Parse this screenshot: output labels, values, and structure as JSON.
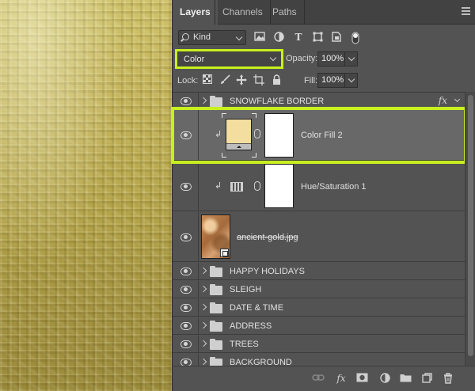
{
  "tabs": [
    {
      "label": "Layers",
      "active": true
    },
    {
      "label": "Channels",
      "active": false
    },
    {
      "label": "Paths",
      "active": false
    }
  ],
  "filter": {
    "kind_label": "Kind",
    "icons": [
      "image-filter-icon",
      "adjustment-filter-icon",
      "type-filter-icon",
      "shape-filter-icon",
      "smart-object-filter-icon",
      "filter-toggle-icon"
    ]
  },
  "blend": {
    "mode": "Color",
    "opacity_label": "Opacity:",
    "opacity_value": "100%"
  },
  "lock": {
    "label": "Lock:",
    "fill_label": "Fill:",
    "fill_value": "100%"
  },
  "layers": [
    {
      "name": "SNOWFLAKE BORDER",
      "type": "group",
      "fx": "fx"
    },
    {
      "name": "Color Fill 2",
      "type": "color-fill",
      "selected": true,
      "fill_color": "#f3dea0"
    },
    {
      "name": "Hue/Saturation 1",
      "type": "adjustment"
    },
    {
      "name": "ancient-gold.jpg",
      "type": "smart-object"
    },
    {
      "name": "HAPPY HOLIDAYS",
      "type": "group"
    },
    {
      "name": "SLEIGH",
      "type": "group"
    },
    {
      "name": "DATE & TIME",
      "type": "group"
    },
    {
      "name": "ADDRESS",
      "type": "group"
    },
    {
      "name": "TREES",
      "type": "group"
    },
    {
      "name": "BACKGROUND",
      "type": "group"
    }
  ],
  "colors": {
    "highlight": "#c8f01e",
    "panel_bg": "#535353",
    "selected_row": "#686868"
  }
}
